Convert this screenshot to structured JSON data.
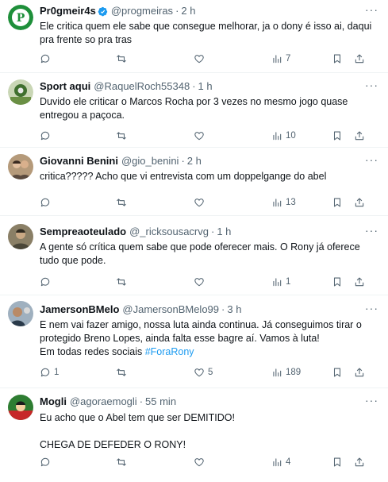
{
  "tweets": [
    {
      "name": "Pr0gmeir4s",
      "verified": true,
      "handle": "@progmeiras",
      "time": "2 h",
      "text": "Ele critica quem ele sabe que consegue melhorar, ja o dony é isso ai, daqui pra frente so pra tras",
      "replies": "",
      "retweets": "",
      "likes": "",
      "views": "7"
    },
    {
      "name": "Sport aqui",
      "handle": "@RaquelRoch55348",
      "time": "1 h",
      "text": "Duvido ele criticar o Marcos Rocha por 3 vezes no mesmo jogo quase entregou a paçoca.",
      "replies": "",
      "retweets": "",
      "likes": "",
      "views": "10"
    },
    {
      "name": "Giovanni Benini",
      "handle": "@gio_benini",
      "time": "2 h",
      "text": "critica????? Acho que vi entrevista com um doppelgange do abel",
      "replies": "",
      "retweets": "",
      "likes": "",
      "views": "13"
    },
    {
      "name": "Sempreaoteulado",
      "handle": "@_ricksousacrvg",
      "time": "1 h",
      "text": "A gente só crítica quem sabe que pode oferecer mais. O Rony já oferece tudo que pode.",
      "replies": "",
      "retweets": "",
      "likes": "",
      "views": "1"
    },
    {
      "name": "JamersonBMelo",
      "handle": "@JamersonBMelo99",
      "time": "3 h",
      "text": "E nem vai fazer amigo, nossa luta ainda continua. Já conseguimos tirar o protegido Breno Lopes, ainda falta esse bagre aí. Vamos à luta!\nEm todas redes sociais ",
      "hashtag": "#ForaRony",
      "replies": "1",
      "retweets": "",
      "likes": "5",
      "views": "189"
    },
    {
      "name": "Mogli",
      "handle": "@agoraemogli",
      "time": "55 min",
      "text": "Eu acho que o Abel tem que ser DEMITIDO!\n\nCHEGA DE DEFEDER O RONY!",
      "replies": "",
      "retweets": "",
      "likes": "",
      "views": "4"
    }
  ],
  "ui": {
    "separator_dot": "·",
    "more_glyph": "···"
  },
  "colors": {
    "text": "#0f1419",
    "secondary": "#536471",
    "link": "#1d9bf0",
    "border": "#eff3f4"
  },
  "icons": [
    "verified-badge-icon",
    "reply-icon",
    "retweet-icon",
    "like-icon",
    "views-icon",
    "bookmark-icon",
    "share-icon",
    "more-icon"
  ]
}
